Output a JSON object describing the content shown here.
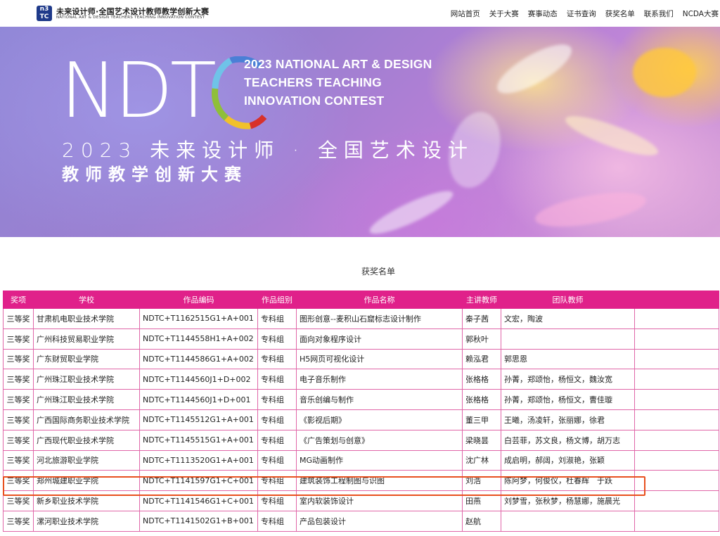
{
  "header": {
    "logo_mark": "n3 TC",
    "logo_cn": "未来设计师·全国艺术设计教师教学创新大赛",
    "logo_en": "NATIONAL ART & DESIGN TEACHERS TEACHING INNOVATION CONTEST",
    "nav": [
      "网站首页",
      "关于大赛",
      "赛事动态",
      "证书查询",
      "获奖名单",
      "联系我们",
      "NCDA大赛"
    ]
  },
  "banner": {
    "big_text": "NDT",
    "en_lines": [
      "2023 NATIONAL ART & DESIGN",
      "TEACHERS TEACHING",
      "INNOVATION CONTEST"
    ],
    "cn_line1": "2023 未来设计师 · 全国艺术设计",
    "cn_line2": "教师教学创新大赛"
  },
  "list_title": "获奖名单",
  "table": {
    "headers": [
      "奖项",
      "学校",
      "作品编码",
      "作品组别",
      "作品名称",
      "主讲教师",
      "团队教师",
      ""
    ],
    "rows": [
      [
        "三等奖",
        "甘肃机电职业技术学院",
        "NDTC+T1162515G1+A+001",
        "专科组",
        "图形创意--麦积山石窟标志设计制作",
        "秦子茜",
        "文宏，陶波",
        ""
      ],
      [
        "三等奖",
        "广州科技贸易职业学院",
        "NDTC+T1144558H1+A+002",
        "专科组",
        "面向对象程序设计",
        "郭秋叶",
        "",
        ""
      ],
      [
        "三等奖",
        "广东财贸职业学院",
        "NDTC+T1144586G1+A+002",
        "专科组",
        "H5网页可视化设计",
        "赖泓君",
        "郭思恩",
        ""
      ],
      [
        "三等奖",
        "广州珠江职业技术学院",
        "NDTC+T1144560J1+D+002",
        "专科组",
        "电子音乐制作",
        "张格格",
        "孙菁，郑颂怡，杨恒文，魏汝宽",
        ""
      ],
      [
        "三等奖",
        "广州珠江职业技术学院",
        "NDTC+T1144560J1+D+001",
        "专科组",
        "音乐创编与制作",
        "张格格",
        "孙菁，郑颂怡，杨恒文，曹佳璇",
        ""
      ],
      [
        "三等奖",
        "广西国际商务职业技术学院",
        "NDTC+T1145512G1+A+001",
        "专科组",
        "《影视后期》",
        "董三甲",
        "王曦，汤凌轩，张丽娜，徐君",
        ""
      ],
      [
        "三等奖",
        "广西现代职业技术学院",
        "NDTC+T1145515G1+A+001",
        "专科组",
        "《广告策划与创意》",
        "梁晓昙",
        "白芸菲，苏文良，杨文博，胡万志",
        ""
      ],
      [
        "三等奖",
        "河北旅游职业学院",
        "NDTC+T1113520G1+A+001",
        "专科组",
        "MG动画制作",
        "沈广林",
        "成启明，郝阔，刘淑艳，张颖",
        ""
      ],
      [
        "三等奖",
        "郑州城建职业学院",
        "NDTC+T1141597G1+C+001",
        "专科组",
        "建筑装饰工程制图与识图",
        "刘浩",
        "陈阿梦，何俊仪，杜春辉　于跃",
        ""
      ],
      [
        "三等奖",
        "新乡职业技术学院",
        "NDTC+T1141546G1+C+001",
        "专科组",
        "室内软装饰设计",
        "田燕",
        "刘梦雪，张秋梦，杨慧娜，施晨光",
        ""
      ],
      [
        "三等奖",
        "漯河职业技术学院",
        "NDTC+T1141502G1+B+001",
        "专科组",
        "产品包装设计",
        "赵航",
        "",
        ""
      ]
    ]
  },
  "colors": {
    "header_bg": "#e0218a",
    "cell_border": "#e066a8",
    "highlight": "#e8501e"
  }
}
